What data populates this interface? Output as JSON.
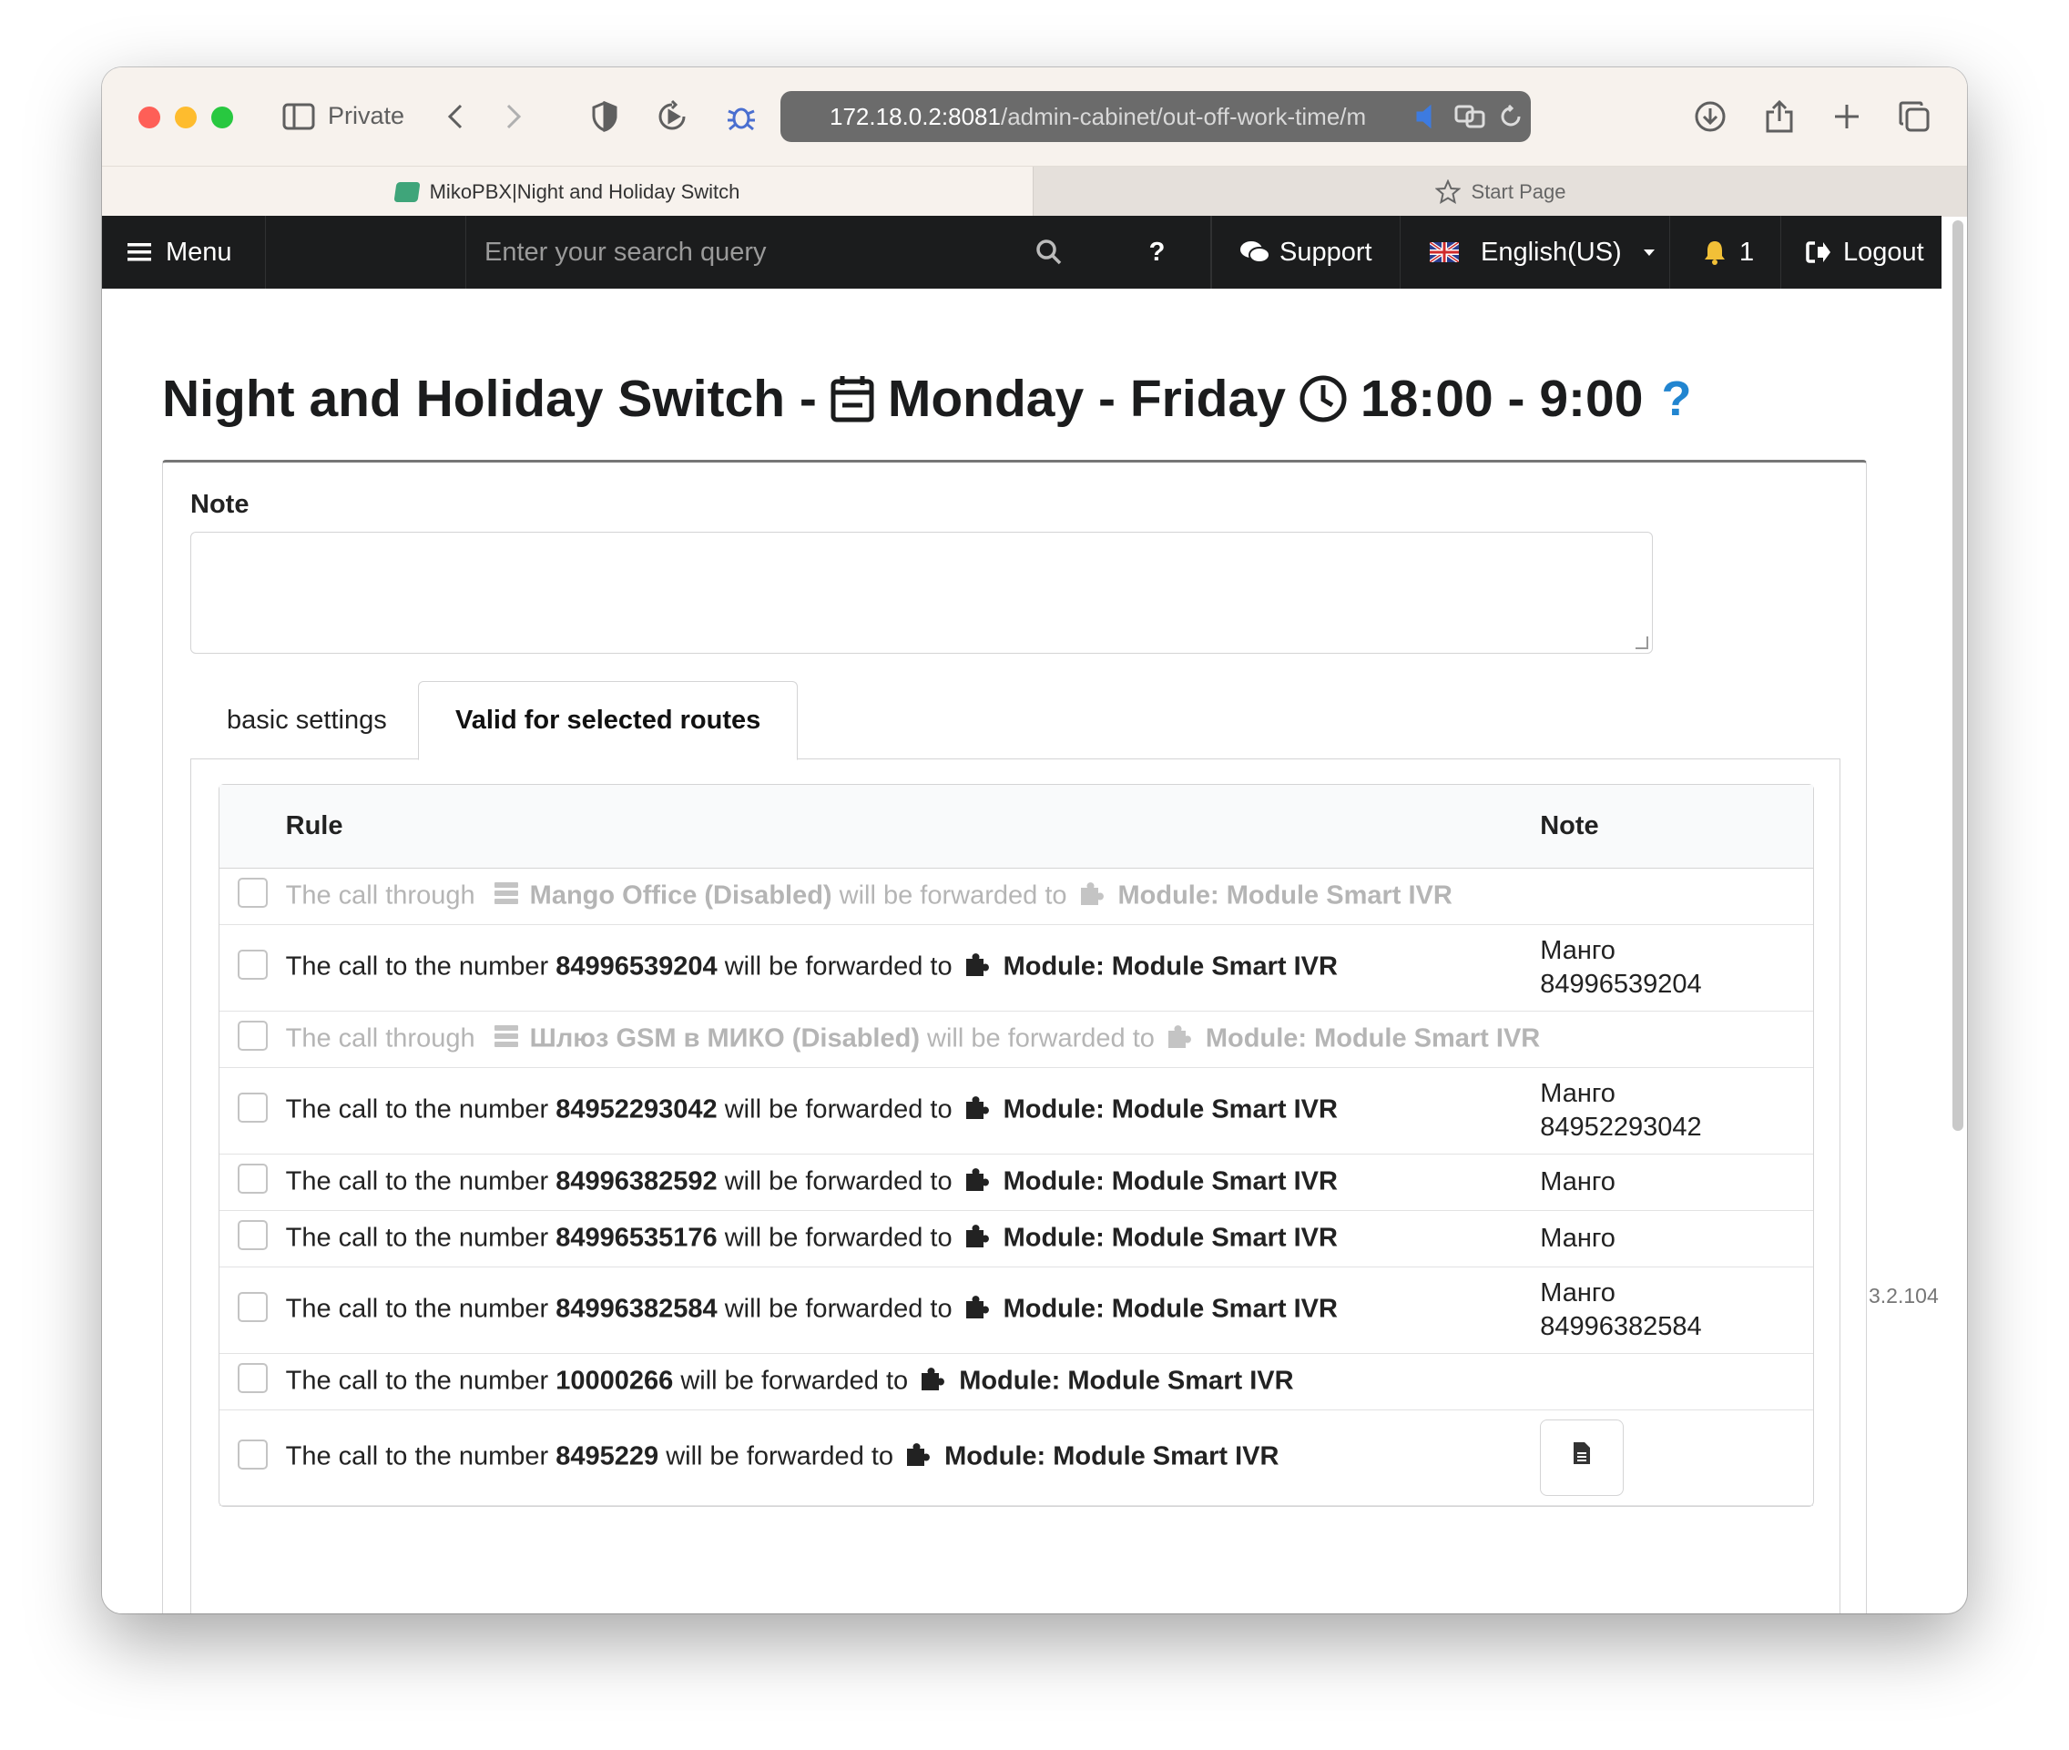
{
  "browser": {
    "private_label": "Private",
    "url_host": "172.18.0.2:8081",
    "url_path": "/admin-cabinet/out-off-work-time/m",
    "tabs": [
      {
        "label": "MikoPBX|Night and Holiday Switch",
        "active": true
      },
      {
        "label": "Start Page",
        "active": false
      }
    ]
  },
  "navbar": {
    "menu_label": "Menu",
    "search_placeholder": "Enter your search query",
    "help_label": "?",
    "support_label": "Support",
    "language_label": "English(US)",
    "notification_count": "1",
    "logout_label": "Logout"
  },
  "page": {
    "title_prefix": "Night and Holiday Switch -",
    "title_days": "Monday - Friday",
    "title_time": "18:00 - 9:00",
    "help_icon": "?"
  },
  "form": {
    "note_label": "Note",
    "note_value": "",
    "tabs": [
      "basic settings",
      "Valid for selected routes"
    ]
  },
  "routes_table": {
    "headers": {
      "rule": "Rule",
      "note": "Note"
    },
    "rows": [
      {
        "type": "provider",
        "disabled": true,
        "pre": "The call through",
        "target": "Mango Office (Disabled)",
        "mid": "will be forwarded to",
        "dest": "Module: Module Smart IVR",
        "note1": "",
        "note2": ""
      },
      {
        "type": "number",
        "disabled": false,
        "pre": "The call to the number",
        "target": "84996539204",
        "mid": "will be forwarded to",
        "dest": "Module: Module Smart IVR",
        "note1": "Манго",
        "note2": "84996539204"
      },
      {
        "type": "provider",
        "disabled": true,
        "pre": "The call through",
        "target": "Шлюз GSM в МИКО (Disabled)",
        "mid": "will be forwarded to",
        "dest": "Module: Module Smart IVR",
        "note1": "",
        "note2": ""
      },
      {
        "type": "number",
        "disabled": false,
        "pre": "The call to the number",
        "target": "84952293042",
        "mid": "will be forwarded to",
        "dest": "Module: Module Smart IVR",
        "note1": "Манго",
        "note2": "84952293042"
      },
      {
        "type": "number",
        "disabled": false,
        "pre": "The call to the number",
        "target": "84996382592",
        "mid": "will be forwarded to",
        "dest": "Module: Module Smart IVR",
        "note1": "Манго",
        "note2": ""
      },
      {
        "type": "number",
        "disabled": false,
        "pre": "The call to the number",
        "target": "84996535176",
        "mid": "will be forwarded to",
        "dest": "Module: Module Smart IVR",
        "note1": "Манго",
        "note2": ""
      },
      {
        "type": "number",
        "disabled": false,
        "pre": "The call to the number",
        "target": "84996382584",
        "mid": "will be forwarded to",
        "dest": "Module: Module Smart IVR",
        "note1": "Манго",
        "note2": "84996382584"
      },
      {
        "type": "number",
        "disabled": false,
        "pre": "The call to the number",
        "target": "10000266",
        "mid": "will be forwarded to",
        "dest": "Module: Module Smart IVR",
        "note1": "",
        "note2": ""
      },
      {
        "type": "number",
        "disabled": false,
        "pre": "The call to the number",
        "target": "8495229",
        "mid": "will be forwarded to",
        "dest": "Module: Module Smart IVR",
        "note1": "",
        "note2": "",
        "note_button": true
      }
    ]
  },
  "version": "3.2.104",
  "colors": {
    "navbar": "#1b1c1d",
    "accent": "#2185d0",
    "disabled_text": "#b5b5b5"
  },
  "icons": [
    "sidebar-icon",
    "back-icon",
    "forward-icon",
    "shield-icon",
    "replay-icon",
    "bug-icon",
    "download-icon",
    "share-icon",
    "new-tab-icon",
    "tabs-overview-icon",
    "menu-icon",
    "search-icon",
    "support-chat-icon",
    "flag-uk-icon",
    "bell-icon",
    "logout-icon",
    "calendar-icon",
    "clock-icon",
    "server-icon",
    "puzzle-icon",
    "document-icon"
  ]
}
